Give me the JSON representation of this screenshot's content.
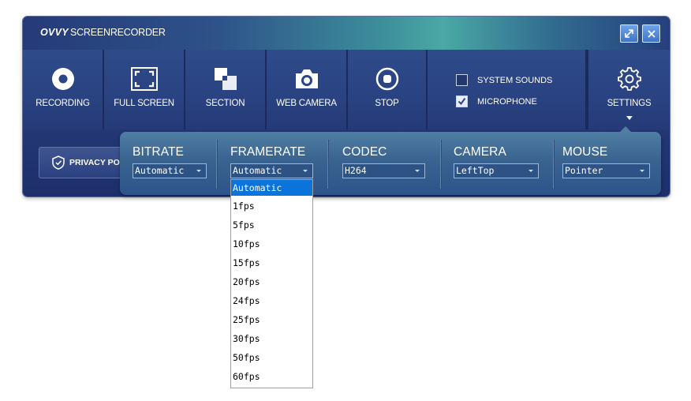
{
  "app": {
    "title_brand": "OVVY",
    "title_rest": "SCREENRECORDER"
  },
  "window_buttons": {
    "maximize_icon": "maximize-icon",
    "close_icon": "close-icon"
  },
  "toolbar": {
    "recording": "RECORDING",
    "full_screen": "FULL SCREEN",
    "section": "SECTION",
    "web_camera": "WEB CAMERA",
    "stop": "STOP",
    "settings": "SETTINGS"
  },
  "options": {
    "system_sounds": {
      "label": "SYSTEM SOUNDS",
      "checked": false
    },
    "microphone": {
      "label": "MICROPHONE",
      "checked": true
    }
  },
  "privacy": {
    "label": "PRIVACY POL"
  },
  "settings_panel": {
    "bitrate": {
      "title": "BITRATE",
      "value": "Automatic"
    },
    "framerate": {
      "title": "FRAMERATE",
      "value": "Automatic"
    },
    "codec": {
      "title": "CODEC",
      "value": "H264"
    },
    "camera": {
      "title": "CAMERA",
      "value": "LeftTop"
    },
    "mouse": {
      "title": "MOUSE",
      "value": "Pointer"
    }
  },
  "framerate_options": [
    "Automatic",
    "1fps",
    "5fps",
    "10fps",
    "15fps",
    "20fps",
    "24fps",
    "25fps",
    "30fps",
    "50fps",
    "60fps"
  ],
  "colors": {
    "accent_selected": "#0a74da",
    "window_bg": "#243a78",
    "panel_bg": "#3a6390"
  }
}
